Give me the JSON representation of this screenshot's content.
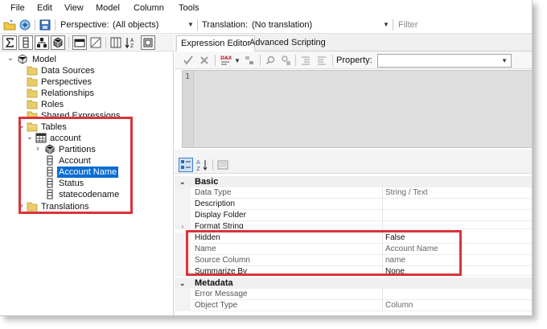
{
  "menu": [
    "File",
    "Edit",
    "View",
    "Model",
    "Column",
    "Tools"
  ],
  "toolbar": {
    "perspective_label": "Perspective:",
    "perspective_value": "(All objects)",
    "translation_label": "Translation:",
    "translation_value": "(No translation)",
    "filter_placeholder": "Filter"
  },
  "tree": {
    "model": "Model",
    "data_sources": "Data Sources",
    "perspectives": "Perspectives",
    "relationships": "Relationships",
    "roles": "Roles",
    "shared_expressions": "Shared Expressions",
    "tables": "Tables",
    "account": "account",
    "partitions": "Partitions",
    "columns": [
      "Account",
      "Account Name",
      "Status",
      "statecodename"
    ],
    "selected_column": "Account Name",
    "translations": "Translations"
  },
  "tabs": {
    "expression_editor": "Expression Editor",
    "advanced_scripting": "Advanced Scripting"
  },
  "editor": {
    "property_label": "Property:",
    "property_value": "",
    "line_number": "1"
  },
  "properties": {
    "basic_category": "Basic",
    "metadata_category": "Metadata",
    "basic_rows": [
      {
        "name": "Data Type",
        "value": "String / Text"
      },
      {
        "name": "Description",
        "value": ""
      },
      {
        "name": "Display Folder",
        "value": ""
      },
      {
        "name": "Format String",
        "value": ""
      },
      {
        "name": "Hidden",
        "value": "False"
      },
      {
        "name": "Name",
        "value": "Account Name"
      },
      {
        "name": "Source Column",
        "value": "name"
      },
      {
        "name": "Summarize By",
        "value": "None"
      }
    ],
    "metadata_rows": [
      {
        "name": "Error Message",
        "value": ""
      },
      {
        "name": "Object Type",
        "value": "Column"
      }
    ]
  },
  "colors": {
    "highlight": "#d9343a",
    "selection": "#0a6cd1",
    "folder": "#e8cd6b"
  }
}
